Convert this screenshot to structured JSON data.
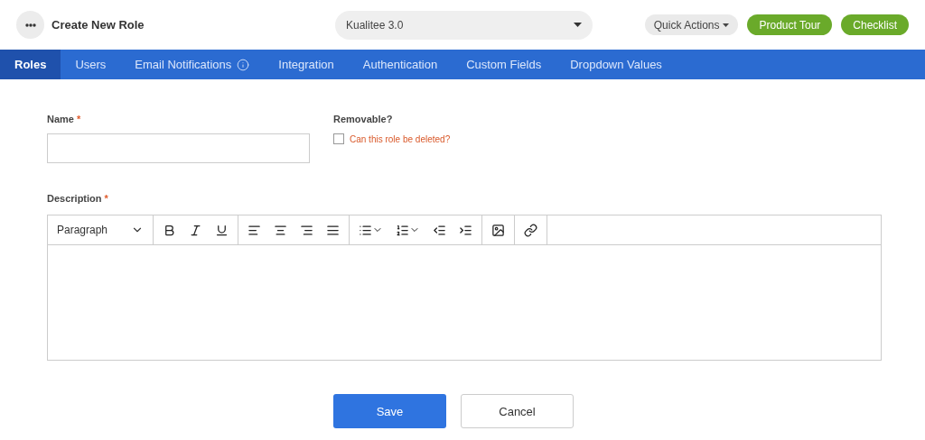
{
  "header": {
    "title": "Create New Role",
    "project": "Kualitee 3.0",
    "quick_actions": "Quick Actions",
    "buttons": [
      "Product Tour",
      "Checklist"
    ]
  },
  "tabs": [
    {
      "label": "Roles",
      "selected": true
    },
    {
      "label": "Users",
      "selected": false
    },
    {
      "label": "Email Notifications",
      "selected": false,
      "info": true
    },
    {
      "label": "Integration",
      "selected": false
    },
    {
      "label": "Authentication",
      "selected": false
    },
    {
      "label": "Custom Fields",
      "selected": false
    },
    {
      "label": "Dropdown Values",
      "selected": false
    }
  ],
  "form": {
    "name": {
      "label": "Name",
      "required_mark": "*"
    },
    "removable": {
      "label": "Removable?",
      "checkbox_label": "Can this role be deleted?",
      "checked": false
    },
    "description": {
      "label": "Description",
      "required_mark": "*",
      "format": "Paragraph"
    }
  },
  "buttons": [
    {
      "label": "Save",
      "kind": "primary"
    },
    {
      "label": "Cancel",
      "kind": "secondary"
    }
  ]
}
